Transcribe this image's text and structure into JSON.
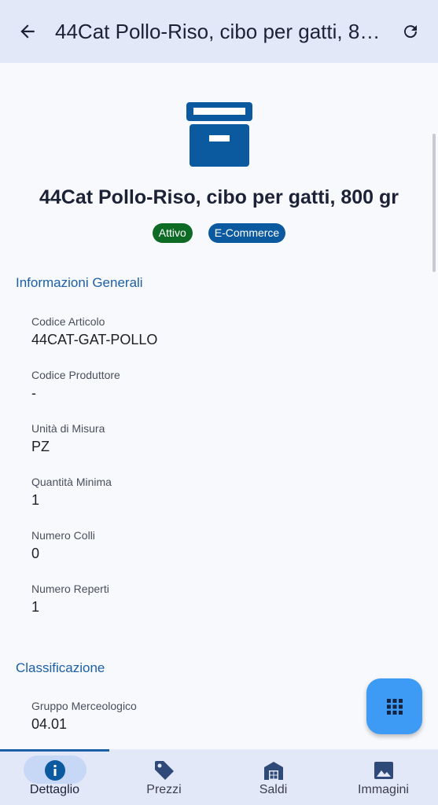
{
  "appbar": {
    "title": "44Cat Pollo-Riso, cibo per gatti, 800 gr",
    "back_icon": "arrow-left-icon",
    "refresh_icon": "refresh-icon"
  },
  "product": {
    "icon": "archive-box-icon",
    "name": "44Cat Pollo-Riso, cibo per gatti, 800 gr",
    "chips": [
      "Attivo",
      "E-Commerce"
    ]
  },
  "sections": {
    "general": {
      "title": "Informazioni Generali",
      "fields": [
        {
          "label": "Codice Articolo",
          "value": "44CAT-GAT-POLLO"
        },
        {
          "label": "Codice Produttore",
          "value": "-"
        },
        {
          "label": "Unità di Misura",
          "value": "PZ"
        },
        {
          "label": "Quantità Minima",
          "value": "1"
        },
        {
          "label": "Numero Colli",
          "value": "0"
        },
        {
          "label": "Numero Reperti",
          "value": "1"
        }
      ]
    },
    "classification": {
      "title": "Classificazione",
      "fields": [
        {
          "label": "Gruppo Merceologico",
          "value": "04.01"
        }
      ]
    }
  },
  "fab": {
    "icon": "grid-icon"
  },
  "bottomnav": {
    "items": [
      {
        "label": "Dettaglio",
        "icon": "info-icon",
        "selected": true
      },
      {
        "label": "Prezzi",
        "icon": "tag-icon",
        "selected": false
      },
      {
        "label": "Saldi",
        "icon": "warehouse-icon",
        "selected": false
      },
      {
        "label": "Immagini",
        "icon": "image-icon",
        "selected": false
      }
    ]
  },
  "colors": {
    "accent": "#1b5fa6",
    "chip_active": "#0d6b25",
    "chip_ecommerce": "#0b5aa0",
    "fab": "#3d9bf5",
    "bar": "#e3e8f8"
  }
}
